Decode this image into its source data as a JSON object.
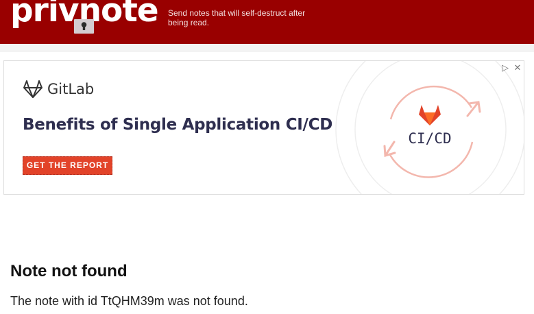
{
  "header": {
    "logo_text": "privnote",
    "tagline": "Send notes that will self-destruct after being read."
  },
  "ad": {
    "brand": "GitLab",
    "headline": "Benefits of Single Application CI/CD",
    "cta": "GET THE REPORT",
    "art_label": "CI/CD",
    "controls": {
      "adchoices_icon": "play-triangle-icon",
      "close_icon": "close-icon"
    },
    "colors": {
      "accent": "#e24329",
      "headline": "#2e2e4f"
    }
  },
  "note": {
    "title": "Note not found",
    "message": "The note with id TtQHM39m was not found."
  },
  "colors": {
    "header_bg": "#990000"
  }
}
